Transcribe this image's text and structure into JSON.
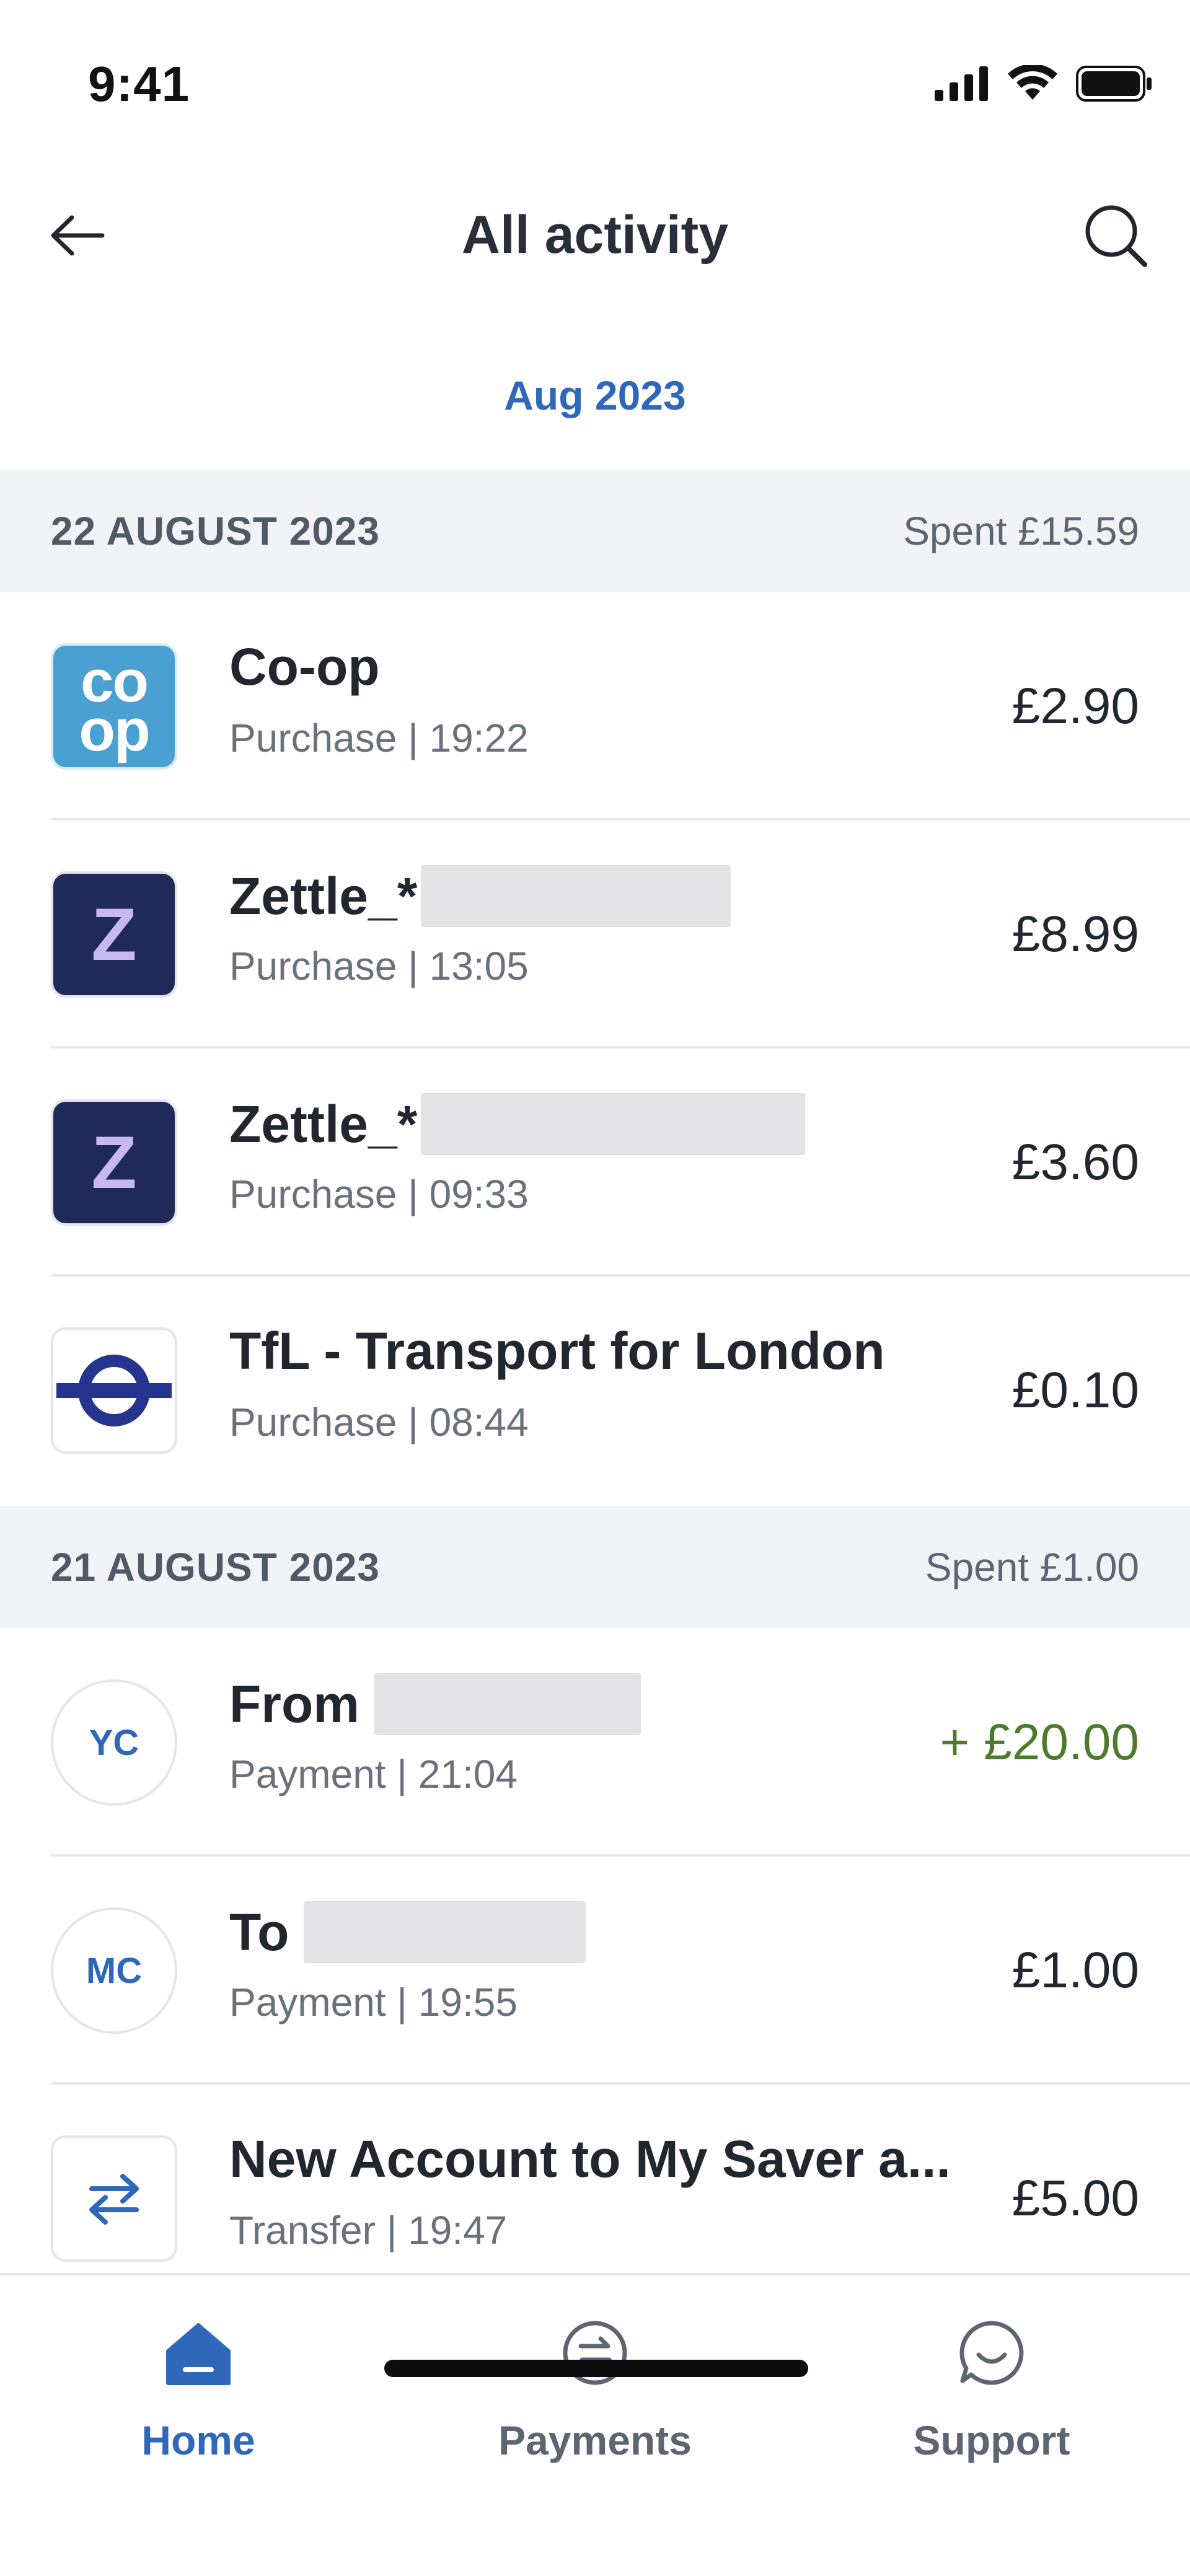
{
  "status_bar": {
    "time": "9:41"
  },
  "header": {
    "title": "All activity"
  },
  "month_selector": "Aug 2023",
  "groups": [
    {
      "date": "22 AUGUST 2023",
      "spent": "Spent £15.59",
      "transactions": [
        {
          "name": "Co-op",
          "type": "Purchase",
          "time": "19:22",
          "subtitle": "Purchase | 19:22",
          "amount": "£2.90",
          "icon": "co-op-logo-icon",
          "logo_text_top": "co",
          "logo_text_bottom": "op"
        },
        {
          "name": "Zettle_*",
          "type": "Purchase",
          "time": "13:05",
          "subtitle": "Purchase | 13:05",
          "amount": "£8.99",
          "icon": "zettle-logo-icon",
          "logo_letter": "Z"
        },
        {
          "name": "Zettle_*",
          "type": "Purchase",
          "time": "09:33",
          "subtitle": "Purchase | 09:33",
          "amount": "£3.60",
          "icon": "zettle-logo-icon",
          "logo_letter": "Z"
        },
        {
          "name": "TfL - Transport for London",
          "type": "Purchase",
          "time": "08:44",
          "subtitle": "Purchase | 08:44",
          "amount": "£0.10",
          "icon": "tfl-roundel-icon"
        }
      ]
    },
    {
      "date": "21 AUGUST 2023",
      "spent": "Spent £1.00",
      "transactions": [
        {
          "name": "From",
          "type": "Payment",
          "time": "21:04",
          "subtitle": "Payment | 21:04",
          "amount": "+ £20.00",
          "initials": "YC",
          "direction": "credit"
        },
        {
          "name": "To",
          "type": "Payment",
          "time": "19:55",
          "subtitle": "Payment | 19:55",
          "amount": "£1.00",
          "initials": "MC"
        },
        {
          "name": "New Account to My Saver a...",
          "type": "Transfer",
          "time": "19:47",
          "subtitle": "Transfer | 19:47",
          "amount": "£5.00",
          "icon": "transfer-arrows-icon"
        }
      ]
    }
  ],
  "bottom_nav": [
    {
      "label": "Home",
      "icon": "home-icon",
      "active": true
    },
    {
      "label": "Payments",
      "icon": "payments-icon",
      "active": false
    },
    {
      "label": "Support",
      "icon": "support-chat-icon",
      "active": false
    }
  ],
  "colors": {
    "accent": "#2f68b8",
    "credit": "#4e7a2c",
    "coop_brand": "#4aa1d1",
    "zettle_brand": "#1f2a5a",
    "tfl_brand": "#25358f"
  }
}
